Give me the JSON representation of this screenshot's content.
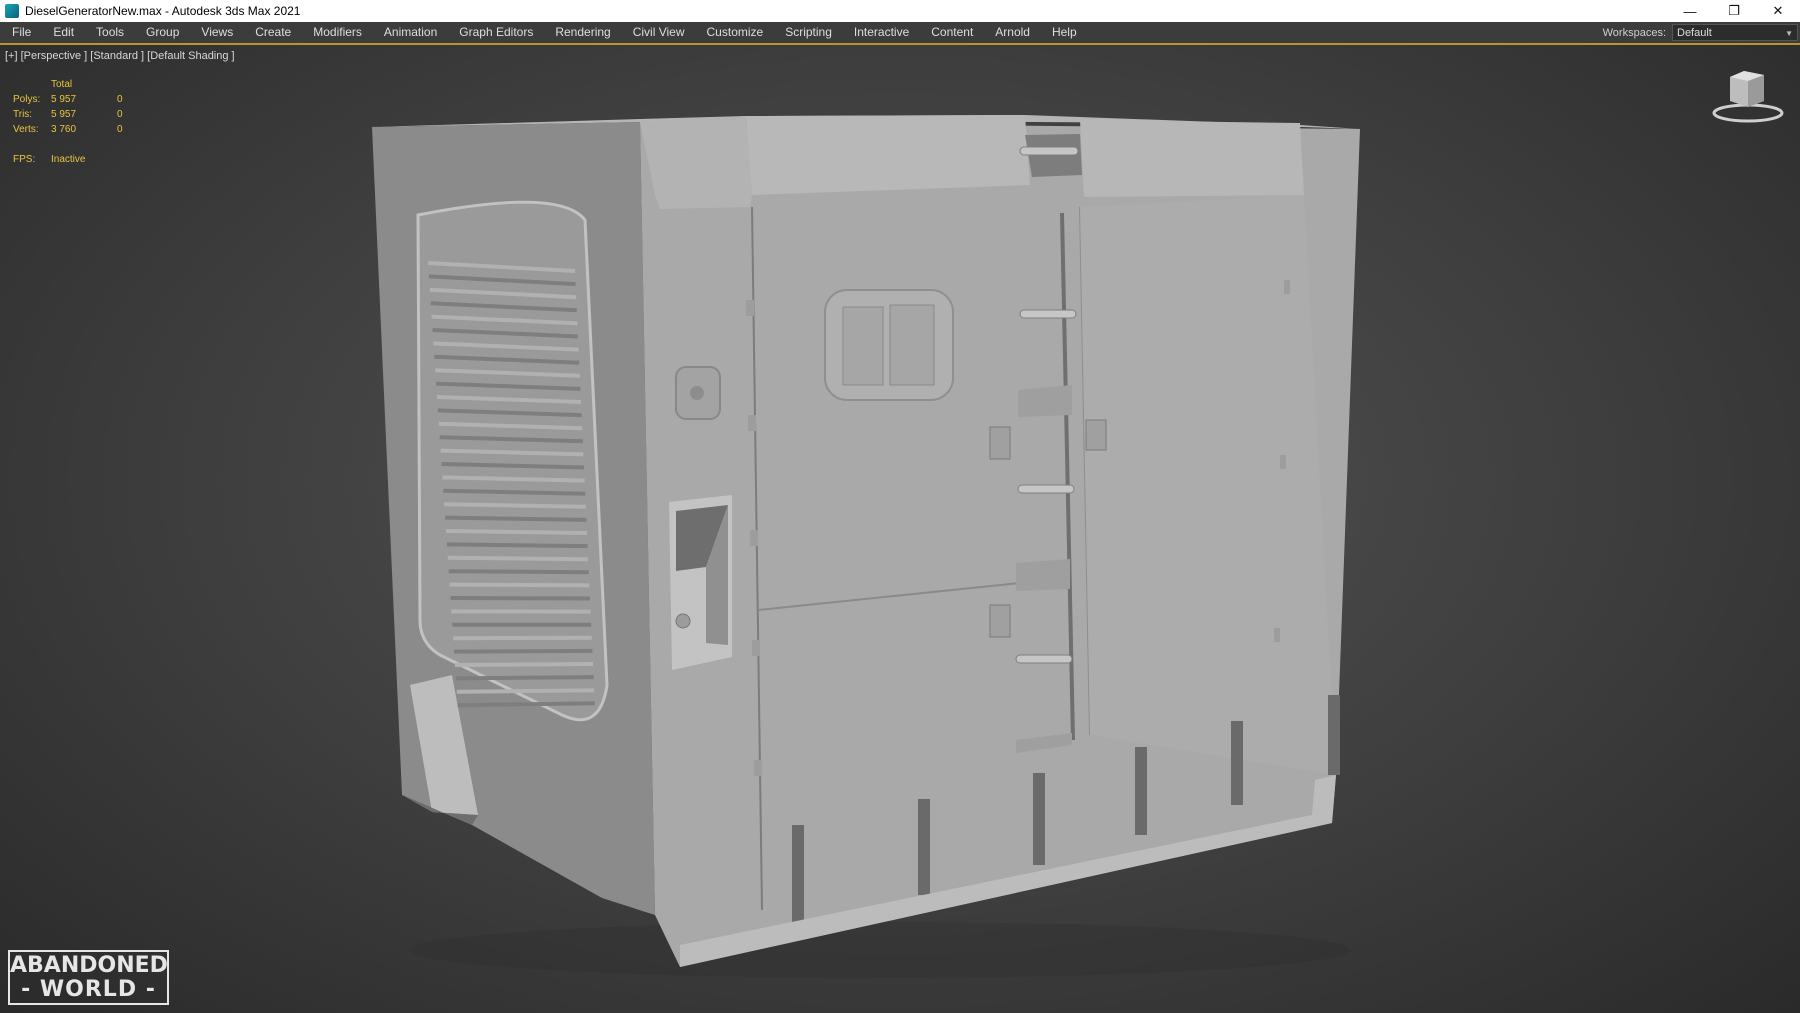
{
  "window": {
    "title": "DieselGeneratorNew.max - Autodesk 3ds Max 2021",
    "controls": {
      "minimize": "—",
      "restore": "❐",
      "close": "✕"
    }
  },
  "menu": {
    "items": [
      "File",
      "Edit",
      "Tools",
      "Group",
      "Views",
      "Create",
      "Modifiers",
      "Animation",
      "Graph Editors",
      "Rendering",
      "Civil View",
      "Customize",
      "Scripting",
      "Interactive",
      "Content",
      "Arnold",
      "Help"
    ]
  },
  "workspaces": {
    "label": "Workspaces:",
    "value": "Default"
  },
  "viewport": {
    "label": "[+] [Perspective ] [Standard ] [Default Shading ]",
    "stats": {
      "header": "Total",
      "polys": {
        "label": "Polys:",
        "total": "5 957",
        "selected": "0"
      },
      "tris": {
        "label": "Tris:",
        "total": "5 957",
        "selected": "0"
      },
      "verts": {
        "label": "Verts:",
        "total": "3 760",
        "selected": "0"
      },
      "fps": {
        "label": "FPS:",
        "value": "Inactive"
      }
    }
  },
  "watermark": {
    "line1": "ABANDONED",
    "line2": "- WORLD -"
  },
  "colors": {
    "menu_bg": "#3c3c3c",
    "accent": "#b8962e",
    "stats": "#e8c33f",
    "model": "#a9a9a9"
  }
}
